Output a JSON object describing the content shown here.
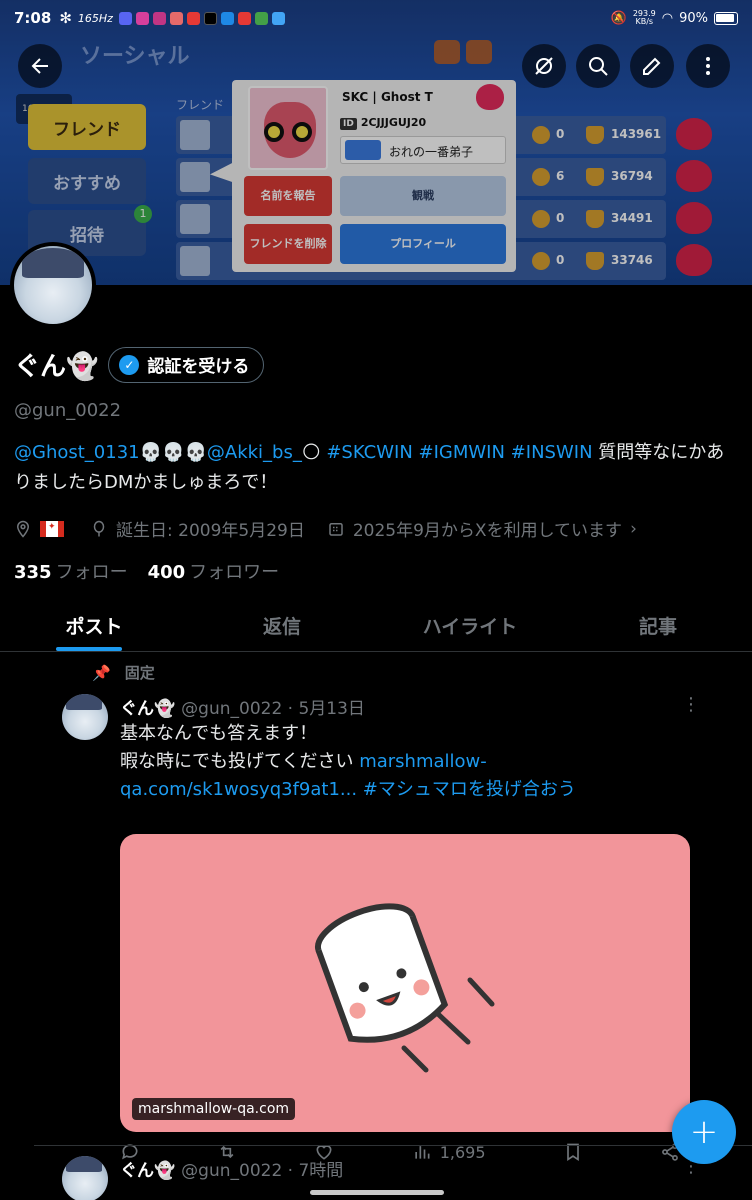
{
  "status_bar": {
    "time": "7:08",
    "refresh_rate": "165Hz",
    "net_speed": "293.9",
    "net_unit": "KB/s",
    "battery": "90%"
  },
  "banner": {
    "game_title": "ソーシャル",
    "clock": "16:27",
    "tabs": [
      "フレンド",
      "おすすめ",
      "招待"
    ],
    "invite_badge": "1",
    "friend_list_label": "フレンド",
    "rows": [
      {
        "coins": "0",
        "trophies": "143961"
      },
      {
        "coins": "6",
        "trophies": "36794"
      },
      {
        "coins": "0",
        "trophies": "34491"
      },
      {
        "coins": "0",
        "trophies": "33746"
      }
    ],
    "popup": {
      "player_name": "SKC | Ghost T",
      "id_tag": "ID",
      "player_id": "2CJJJGUJ20",
      "motto": "おれの一番弟子",
      "report_btn": "名前を報告",
      "watch_btn": "観戦",
      "remove_btn": "フレンドを削除",
      "profile_btn": "プロフィール"
    }
  },
  "profile": {
    "display_name": "ぐん👻",
    "verify_label": "認証を受ける",
    "handle": "@gun_0022",
    "bio_mention1": "@Ghost_0131",
    "bio_skulls": "💀💀💀",
    "bio_mention2": "@Akki_bs_",
    "bio_moon": "🌕",
    "bio_tags": " #SKCWIN #IGMWIN #INSWIN",
    "bio_text": " 質問等なにかありましたらDMかましゅまろで！",
    "location_flag": "🇨🇦",
    "birthday": "誕生日: 2009年5月29日",
    "joined": "2025年9月からXを利用しています",
    "following_count": "335",
    "following_label": "フォロー",
    "followers_count": "400",
    "followers_label": "フォロワー"
  },
  "tabs": [
    "ポスト",
    "返信",
    "ハイライト",
    "記事"
  ],
  "pinned_label": "固定",
  "tweet1": {
    "name": "ぐん👻",
    "handle_time": "@gun_0022 · 5月13日",
    "line1": "基本なんでも答えます！",
    "line2": "暇な時にでも投げてください ",
    "link": "marshmallow-qa.com/sk1wosyq3f9at1...",
    "hashtag": " #マシュマロを投げ合おう",
    "card_domain": "marshmallow-qa.com",
    "views": "1,695"
  },
  "tweet2": {
    "name": "ぐん👻",
    "handle_time": "@gun_0022 · 7時間"
  },
  "colors": {
    "accent": "#1d9bf0",
    "background": "#000000",
    "card": "#f2959a"
  }
}
